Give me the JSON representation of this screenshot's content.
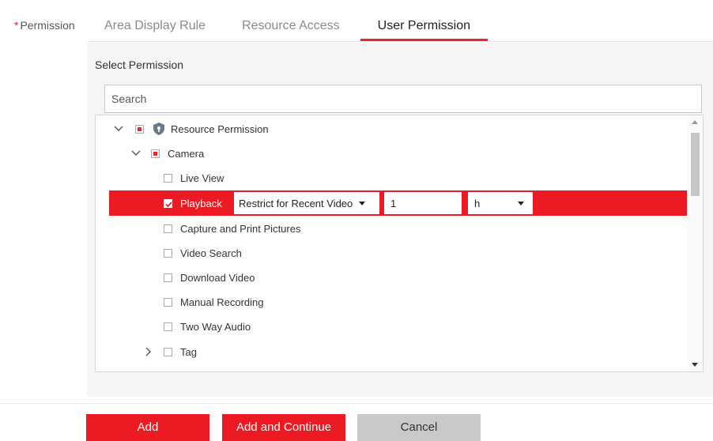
{
  "form": {
    "required_mark": "*",
    "permission_label": "Permission"
  },
  "tabs": [
    {
      "label": "Area Display Rule",
      "active": false
    },
    {
      "label": "Resource Access",
      "active": false
    },
    {
      "label": "User Permission",
      "active": true
    }
  ],
  "panel": {
    "title": "Select Permission",
    "search_placeholder": "Search"
  },
  "tree": {
    "root": {
      "label": "Resource Permission",
      "expanded": true,
      "state": "partial"
    },
    "camera": {
      "label": "Camera",
      "expanded": true,
      "state": "partial"
    },
    "items": [
      {
        "label": "Live View",
        "checked": false
      },
      {
        "label": "Playback",
        "checked": true
      },
      {
        "label": "Capture and Print Pictures",
        "checked": false
      },
      {
        "label": "Video Search",
        "checked": false
      },
      {
        "label": "Download Video",
        "checked": false
      },
      {
        "label": "Manual Recording",
        "checked": false
      },
      {
        "label": "Two Way Audio",
        "checked": false
      }
    ],
    "tag": {
      "label": "Tag",
      "expanded": false,
      "checked": false
    },
    "playback_options": {
      "restriction": "Restrict for Recent Video",
      "amount": "1",
      "unit": "h"
    }
  },
  "buttons": {
    "add": "Add",
    "add_continue": "Add and Continue",
    "cancel": "Cancel"
  },
  "colors": {
    "accent": "#ec1b23",
    "disabled_button": "#c9c9c9"
  }
}
